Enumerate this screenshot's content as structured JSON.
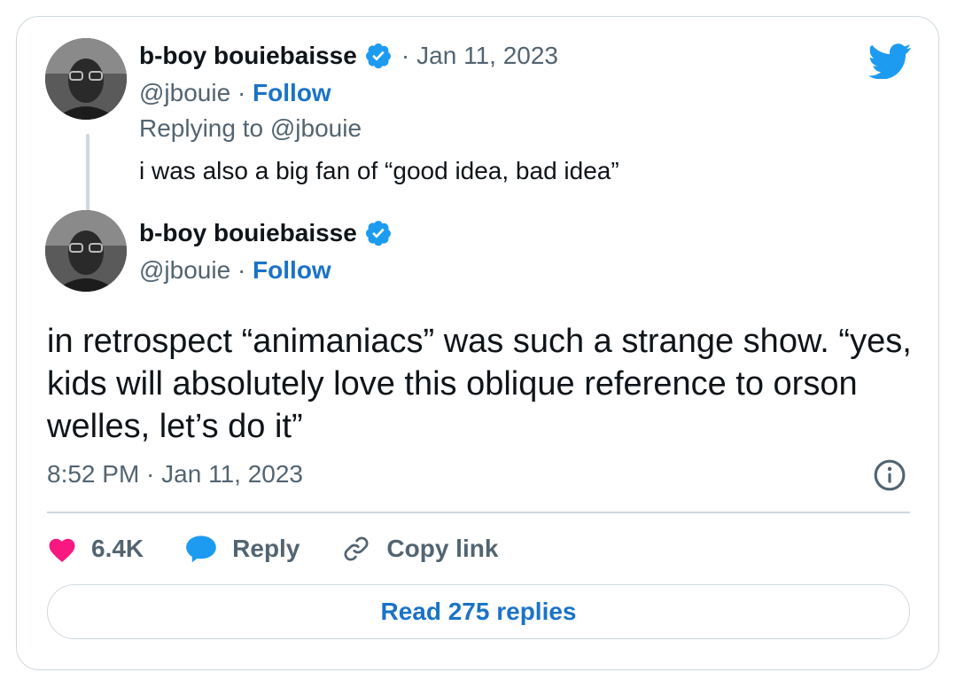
{
  "parent_tweet": {
    "display_name": "b-boy bouiebaisse",
    "separator": "·",
    "date": "Jan 11, 2023",
    "handle": "@jbouie",
    "handle_sep": "·",
    "follow_label": "Follow",
    "replying_to": "Replying to @jbouie",
    "text": "i was also a big fan of “good idea, bad idea”"
  },
  "main_tweet": {
    "display_name": "b-boy bouiebaisse",
    "handle": "@jbouie",
    "handle_sep": "·",
    "follow_label": "Follow",
    "text": "in retrospect “animaniacs” was such a strange show. “yes, kids will absolutely love this oblique reference to orson welles, let’s do it”",
    "timestamp": "8:52 PM · Jan 11, 2023"
  },
  "actions": {
    "likes": "6.4K",
    "reply_label": "Reply",
    "copy_link_label": "Copy link"
  },
  "read_replies_label": "Read 275 replies",
  "icons": {
    "brand": "twitter-bird-icon",
    "verified": "verified-badge-icon",
    "like": "heart-icon",
    "reply": "speech-bubble-icon",
    "copy": "link-icon",
    "info": "info-icon"
  },
  "colors": {
    "brand_blue": "#1d9bf0",
    "link_blue": "#1a73c7",
    "heart_pink": "#f91880",
    "muted_text": "#536471",
    "border": "#cfd9de"
  }
}
